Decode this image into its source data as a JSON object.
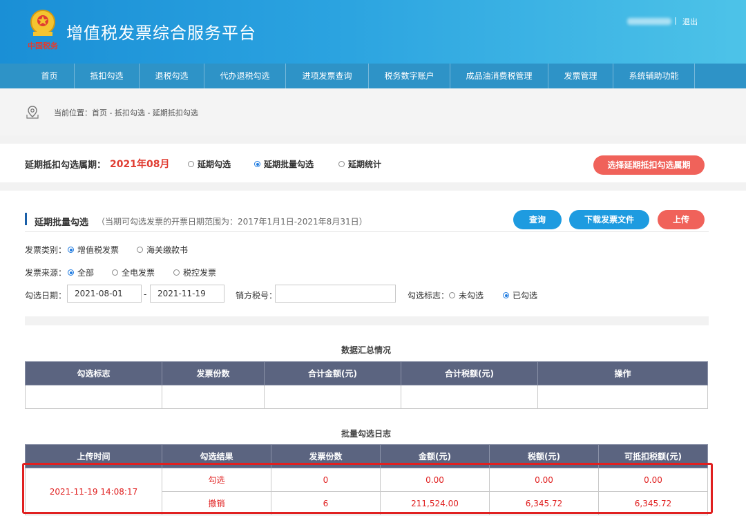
{
  "header": {
    "title": "增值税发票综合服务平台",
    "emblem_caption": "中国税务",
    "separator": "|",
    "logout": "退出"
  },
  "nav": {
    "items": [
      "首页",
      "抵扣勾选",
      "退税勾选",
      "代办退税勾选",
      "进项发票查询",
      "税务数字账户",
      "成品油消费税管理",
      "发票管理",
      "系统辅助功能"
    ]
  },
  "breadcrumb": {
    "icon": "location-pin-icon",
    "text": "当前位置：首页 - 抵扣勾选 - 延期抵扣勾选"
  },
  "period": {
    "label": "延期抵扣勾选属期：",
    "value": "2021年08月",
    "options": [
      {
        "label": "延期勾选",
        "selected": false
      },
      {
        "label": "延期批量勾选",
        "selected": true
      },
      {
        "label": "延期统计",
        "selected": false
      }
    ],
    "select_button": "选择延期抵扣勾选属期"
  },
  "section": {
    "title": "延期批量勾选",
    "note": "（当期可勾选发票的开票日期范围为：2017年1月1日-2021年8月31日）",
    "buttons": {
      "query": "查询",
      "download": "下载发票文件",
      "upload": "上传"
    }
  },
  "form": {
    "invoice_type_label": "发票类别：",
    "invoice_type_options": [
      {
        "label": "增值税发票",
        "selected": true
      },
      {
        "label": "海关缴款书",
        "selected": false
      }
    ],
    "source_label": "发票来源：",
    "source_options": [
      {
        "label": "全部",
        "selected": true
      },
      {
        "label": "全电发票",
        "selected": false
      },
      {
        "label": "税控发票",
        "selected": false
      }
    ],
    "date_label": "勾选日期：",
    "date_from": "2021-08-01",
    "date_sep": "-",
    "date_to": "2021-11-19",
    "seller_tax_label": "销方税号：",
    "seller_tax_value": "",
    "flag_label": "勾选标志：",
    "flag_options": [
      {
        "label": "未勾选",
        "selected": false
      },
      {
        "label": "已勾选",
        "selected": true
      }
    ]
  },
  "summary": {
    "caption": "数据汇总情况",
    "headers": [
      "勾选标志",
      "发票份数",
      "合计金额(元)",
      "合计税额(元)",
      "操作"
    ]
  },
  "log": {
    "caption": "批量勾选日志",
    "headers": [
      "上传时间",
      "勾选结果",
      "发票份数",
      "金额(元)",
      "税额(元)",
      "可抵扣税额(元)"
    ],
    "upload_time": "2021-11-19 14:08:17",
    "rows": [
      {
        "result": "勾选",
        "count": "0",
        "amount": "0.00",
        "tax": "0.00",
        "deductible": "0.00"
      },
      {
        "result": "撤销",
        "count": "6",
        "amount": "211,524.00",
        "tax": "6,345.72",
        "deductible": "6,345.72"
      }
    ]
  },
  "colors": {
    "accent_red": "#e03c31",
    "header_blue": "#1a8fd6",
    "nav_blue": "#2e93c7",
    "table_header": "#5b6480",
    "highlight": "#e02020"
  }
}
